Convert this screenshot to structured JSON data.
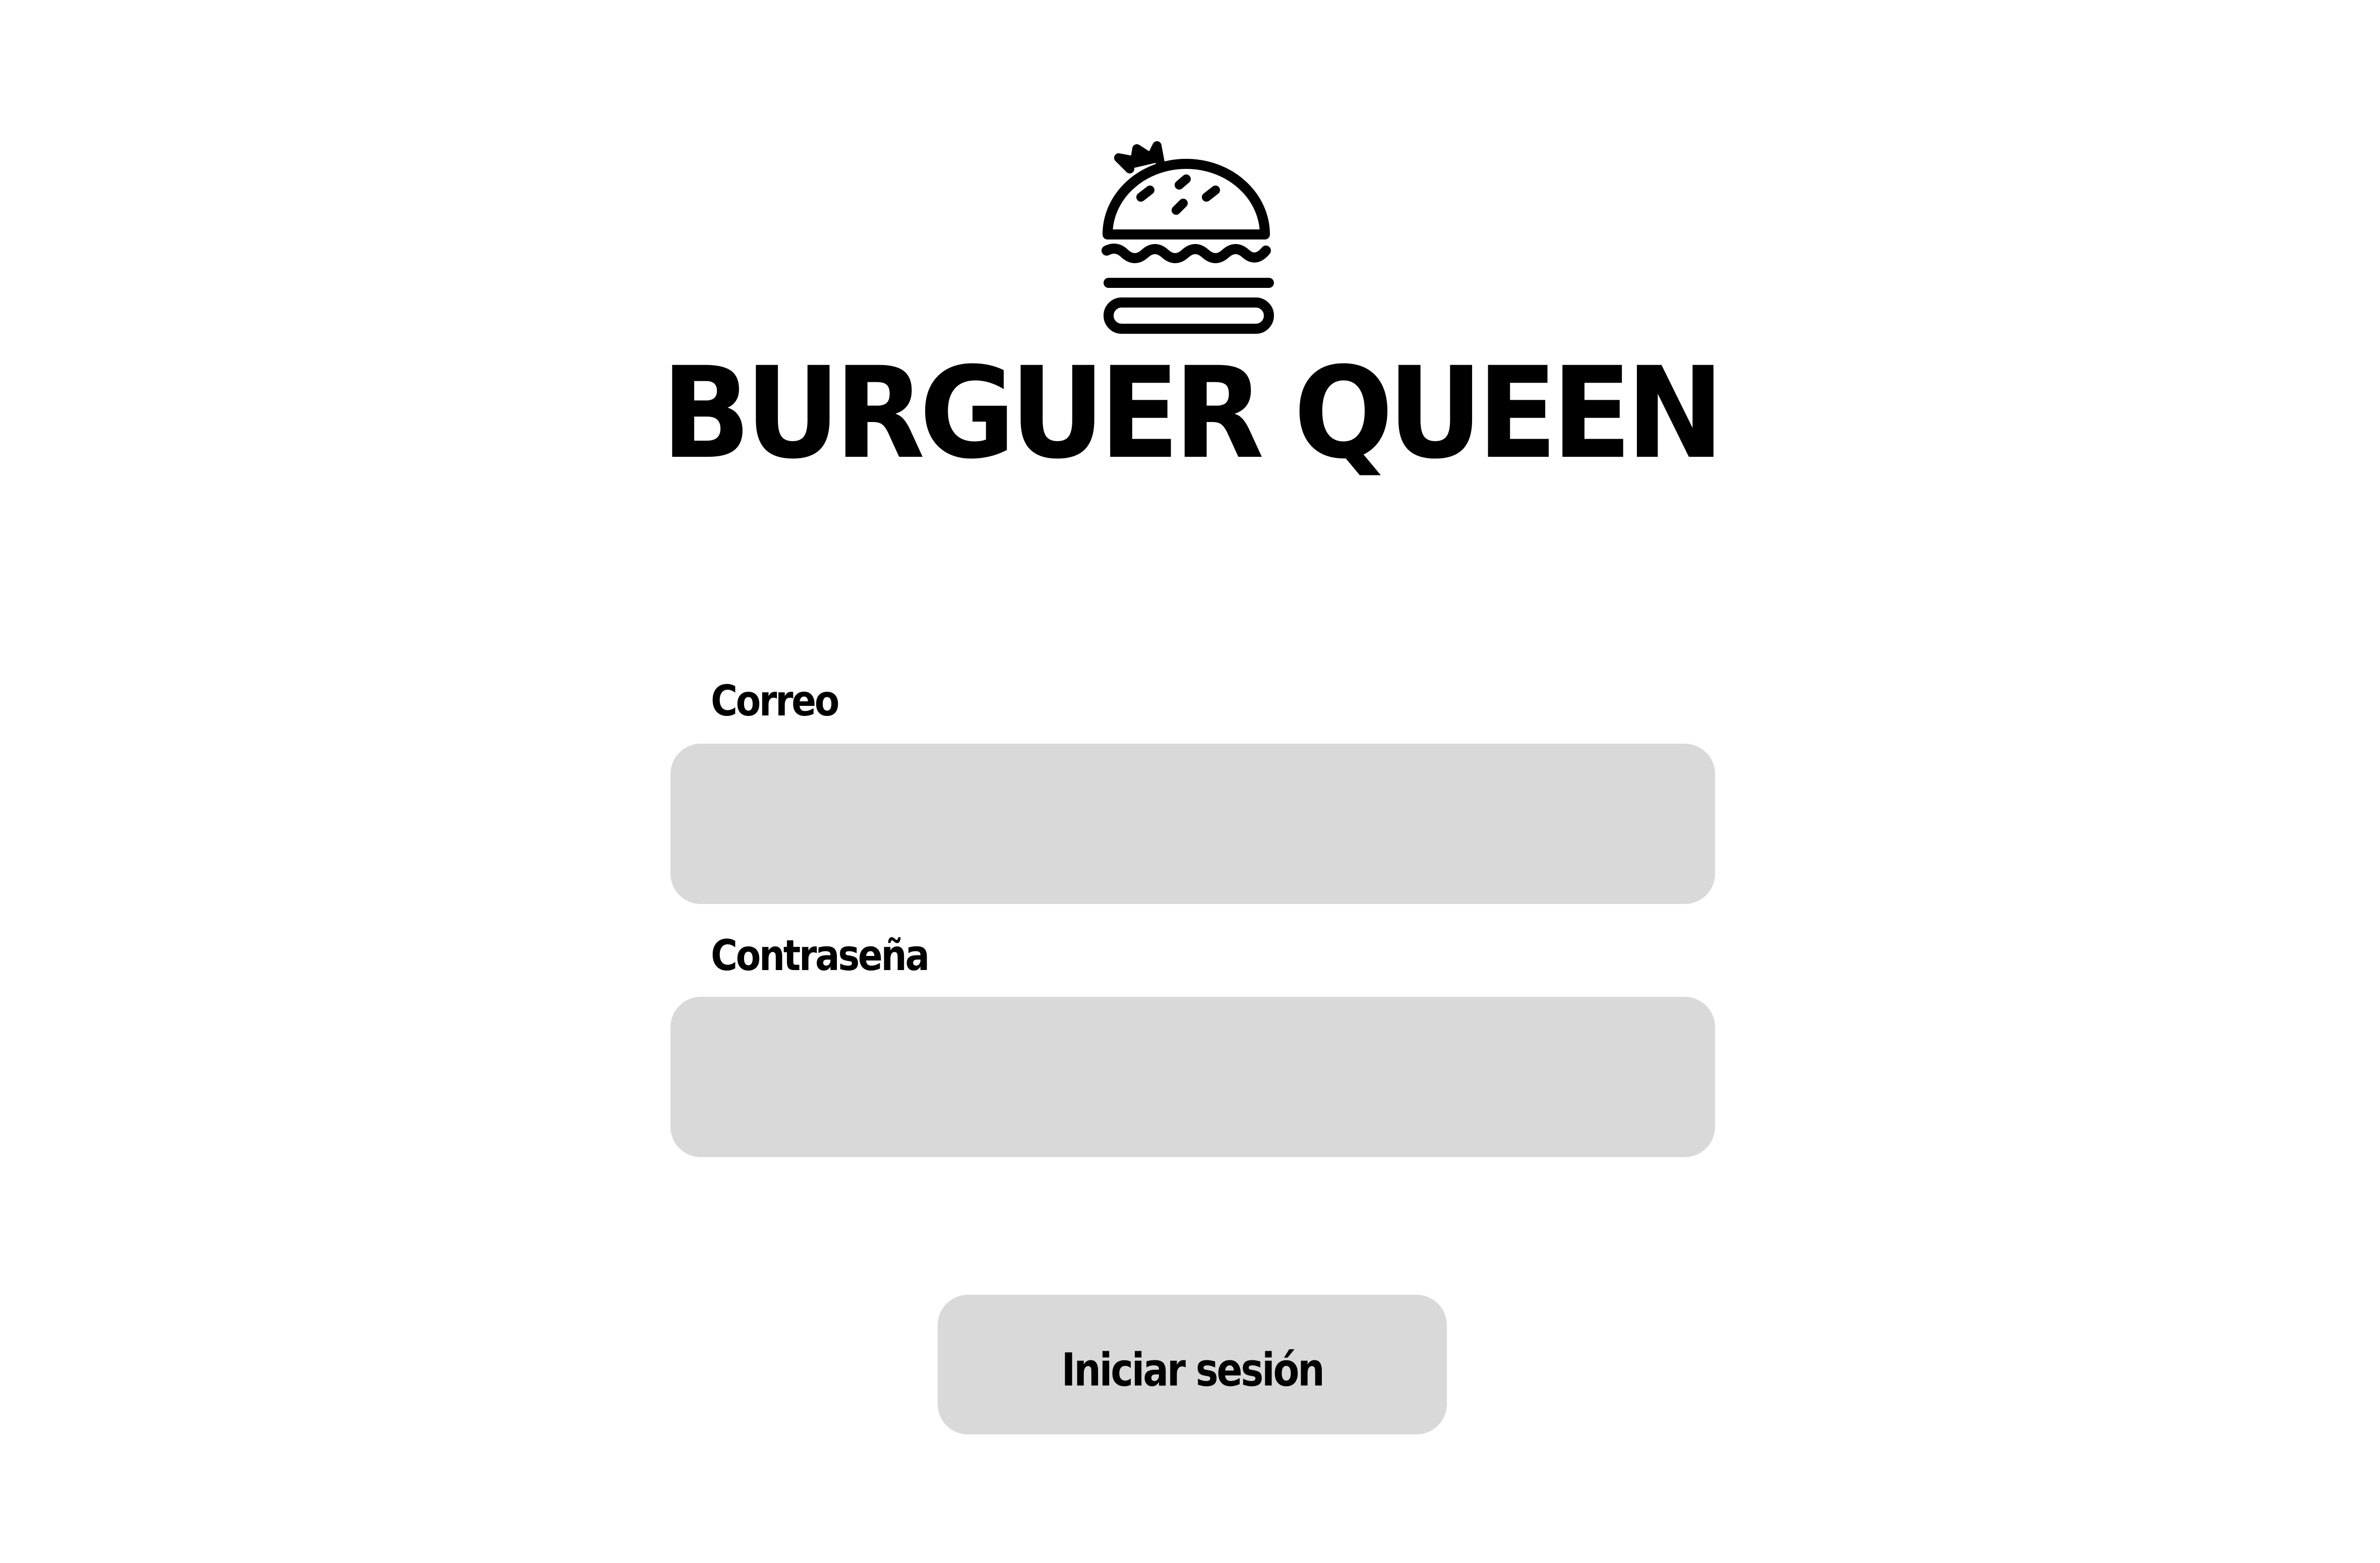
{
  "brand": {
    "title": "BURGUER QUEEN",
    "logo_icon": "burger-with-crown-icon"
  },
  "login_form": {
    "email": {
      "label": "Correo",
      "value": "",
      "placeholder": ""
    },
    "password": {
      "label": "Contraseña",
      "value": "",
      "placeholder": ""
    },
    "submit_label": "Iniciar sesión"
  },
  "colors": {
    "background": "#ffffff",
    "input_fill": "#d9d9d9",
    "text": "#000000"
  }
}
